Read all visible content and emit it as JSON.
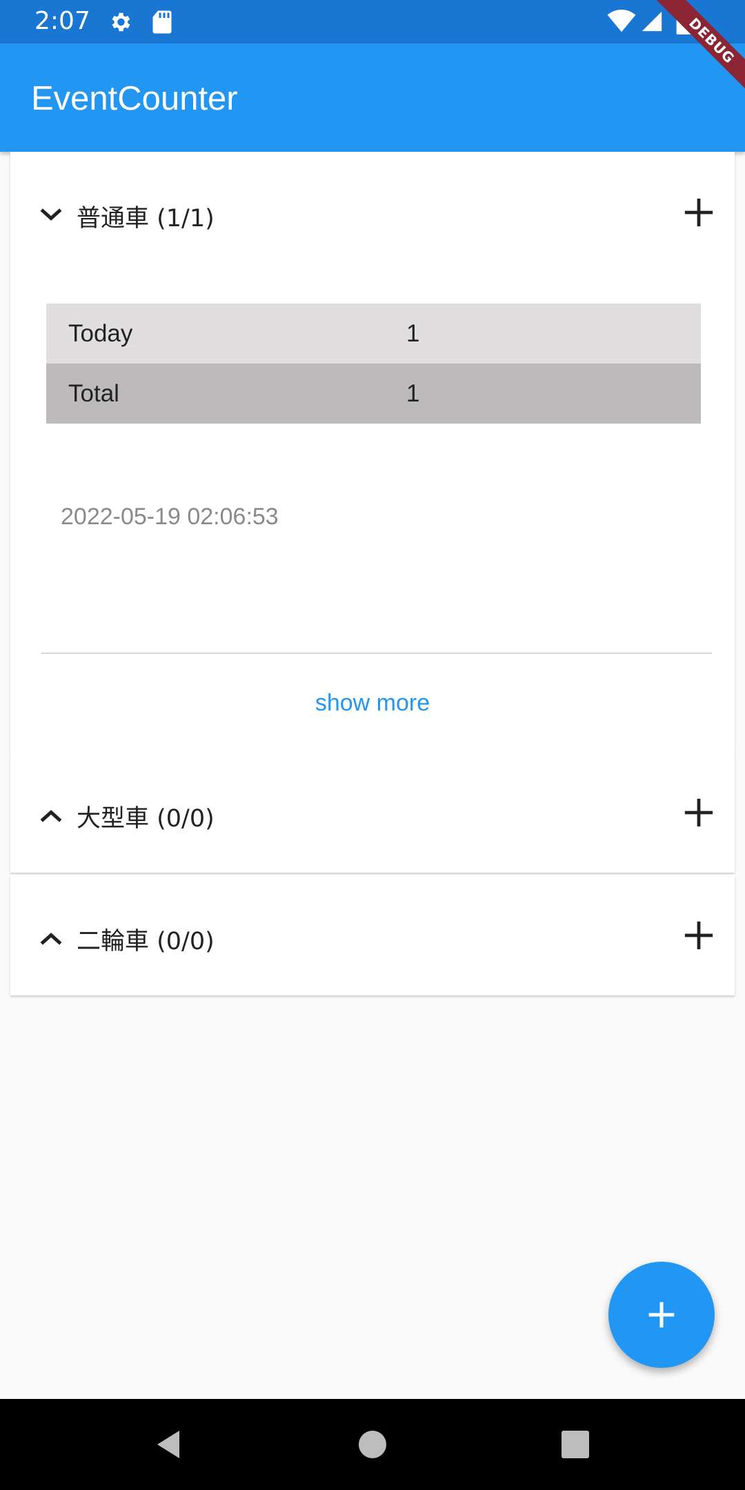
{
  "status_bar": {
    "time": "2:07",
    "icons": [
      "gear-icon",
      "sd-card-icon",
      "wifi-icon",
      "cell-signal-icon",
      "battery-icon"
    ]
  },
  "debug_banner": "DEBUG",
  "app_bar": {
    "title": "EventCounter"
  },
  "panels": [
    {
      "title": "普通車 (1/1)",
      "expanded": true,
      "stats": [
        {
          "label": "Today",
          "value": "1"
        },
        {
          "label": "Total",
          "value": "1"
        }
      ],
      "events": [
        "2022-05-19 02:06:53"
      ],
      "show_more_label": "show more"
    },
    {
      "title": "大型車 (0/0)",
      "expanded": false
    },
    {
      "title": "二輪車 (0/0)",
      "expanded": false
    }
  ],
  "fab": {
    "icon": "plus-icon"
  },
  "nav_bar": {
    "icons": [
      "back-icon",
      "home-icon",
      "recents-icon"
    ]
  },
  "colors": {
    "primary": "#2196f3",
    "primary_dark": "#1976d2",
    "today_row": "#e0dede",
    "total_row": "#bdbabb",
    "link": "#2196f3",
    "timestamp": "#8a8a8a"
  }
}
